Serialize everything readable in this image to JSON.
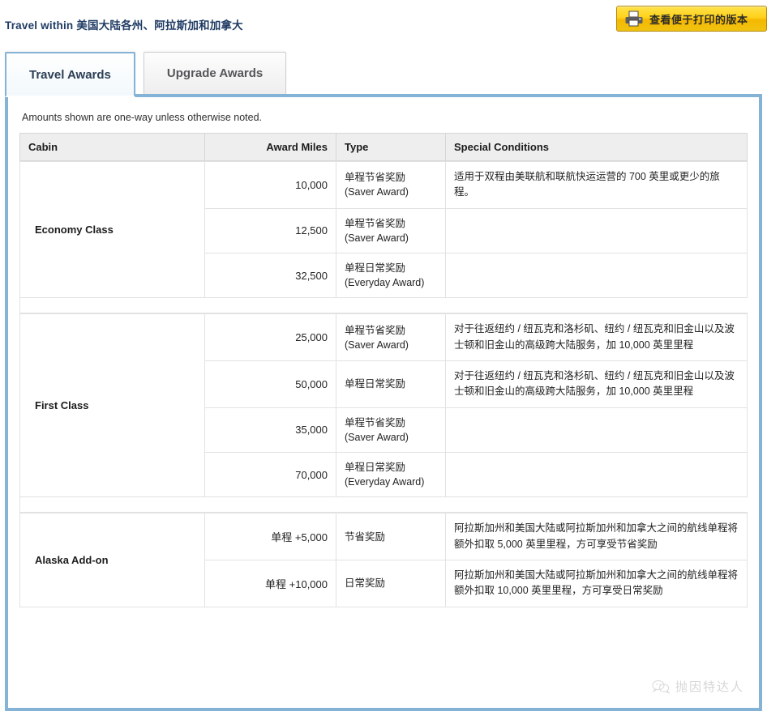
{
  "header": {
    "title_en": "Travel within",
    "title_zh": "美国大陆各州、阿拉斯加和加拿大",
    "print_button_label": "查看便于打印的版本",
    "print_icon": "printer-icon"
  },
  "tabs": [
    {
      "label": "Travel Awards",
      "active": true
    },
    {
      "label": "Upgrade Awards",
      "active": false
    }
  ],
  "panel": {
    "note": "Amounts shown are one-way unless otherwise noted."
  },
  "table": {
    "columns": [
      "Cabin",
      "Award Miles",
      "Type",
      "Special Conditions"
    ],
    "groups": [
      {
        "cabin": "Economy Class",
        "rows": [
          {
            "miles": "10,000",
            "type": "单程节省奖励\n(Saver Award)",
            "conditions": "适用于双程由美联航和联航快运运营的 700 英里或更少的旅程。"
          },
          {
            "miles": "12,500",
            "type": "单程节省奖励\n(Saver Award)",
            "conditions": ""
          },
          {
            "miles": "32,500",
            "type": "单程日常奖励\n(Everyday Award)",
            "conditions": ""
          }
        ]
      },
      {
        "cabin": "First Class",
        "rows": [
          {
            "miles": "25,000",
            "type": "单程节省奖励\n(Saver Award)",
            "conditions": "对于往返纽约 / 纽瓦克和洛杉矶、纽约 / 纽瓦克和旧金山以及波士顿和旧金山的高级跨大陆服务，加 10,000 英里里程"
          },
          {
            "miles": "50,000",
            "type": "单程日常奖励",
            "conditions": "对于往返纽约 / 纽瓦克和洛杉矶、纽约 / 纽瓦克和旧金山以及波士顿和旧金山的高级跨大陆服务，加 10,000 英里里程"
          },
          {
            "miles": "35,000",
            "type": "单程节省奖励\n(Saver Award)",
            "conditions": ""
          },
          {
            "miles": "70,000",
            "type": "单程日常奖励\n(Everyday Award)",
            "conditions": ""
          }
        ]
      },
      {
        "cabin": "Alaska Add-on",
        "rows": [
          {
            "miles": "单程 +5,000",
            "type": "节省奖励",
            "conditions": "阿拉斯加州和美国大陆或阿拉斯加州和加拿大之间的航线单程将额外扣取 5,000 英里里程，方可享受节省奖励"
          },
          {
            "miles": "单程 +10,000",
            "type": "日常奖励",
            "conditions": "阿拉斯加州和美国大陆或阿拉斯加州和加拿大之间的航线单程将额外扣取 10,000 英里里程，方可享受日常奖励"
          }
        ]
      }
    ]
  },
  "watermark": {
    "text": "抛因特达人",
    "icon": "wechat-icon"
  },
  "colors": {
    "accent_blue": "#85b3d6",
    "title_blue": "#1f3b63",
    "button_yellow": "#ffd21c",
    "header_gray": "#eeeeee"
  }
}
